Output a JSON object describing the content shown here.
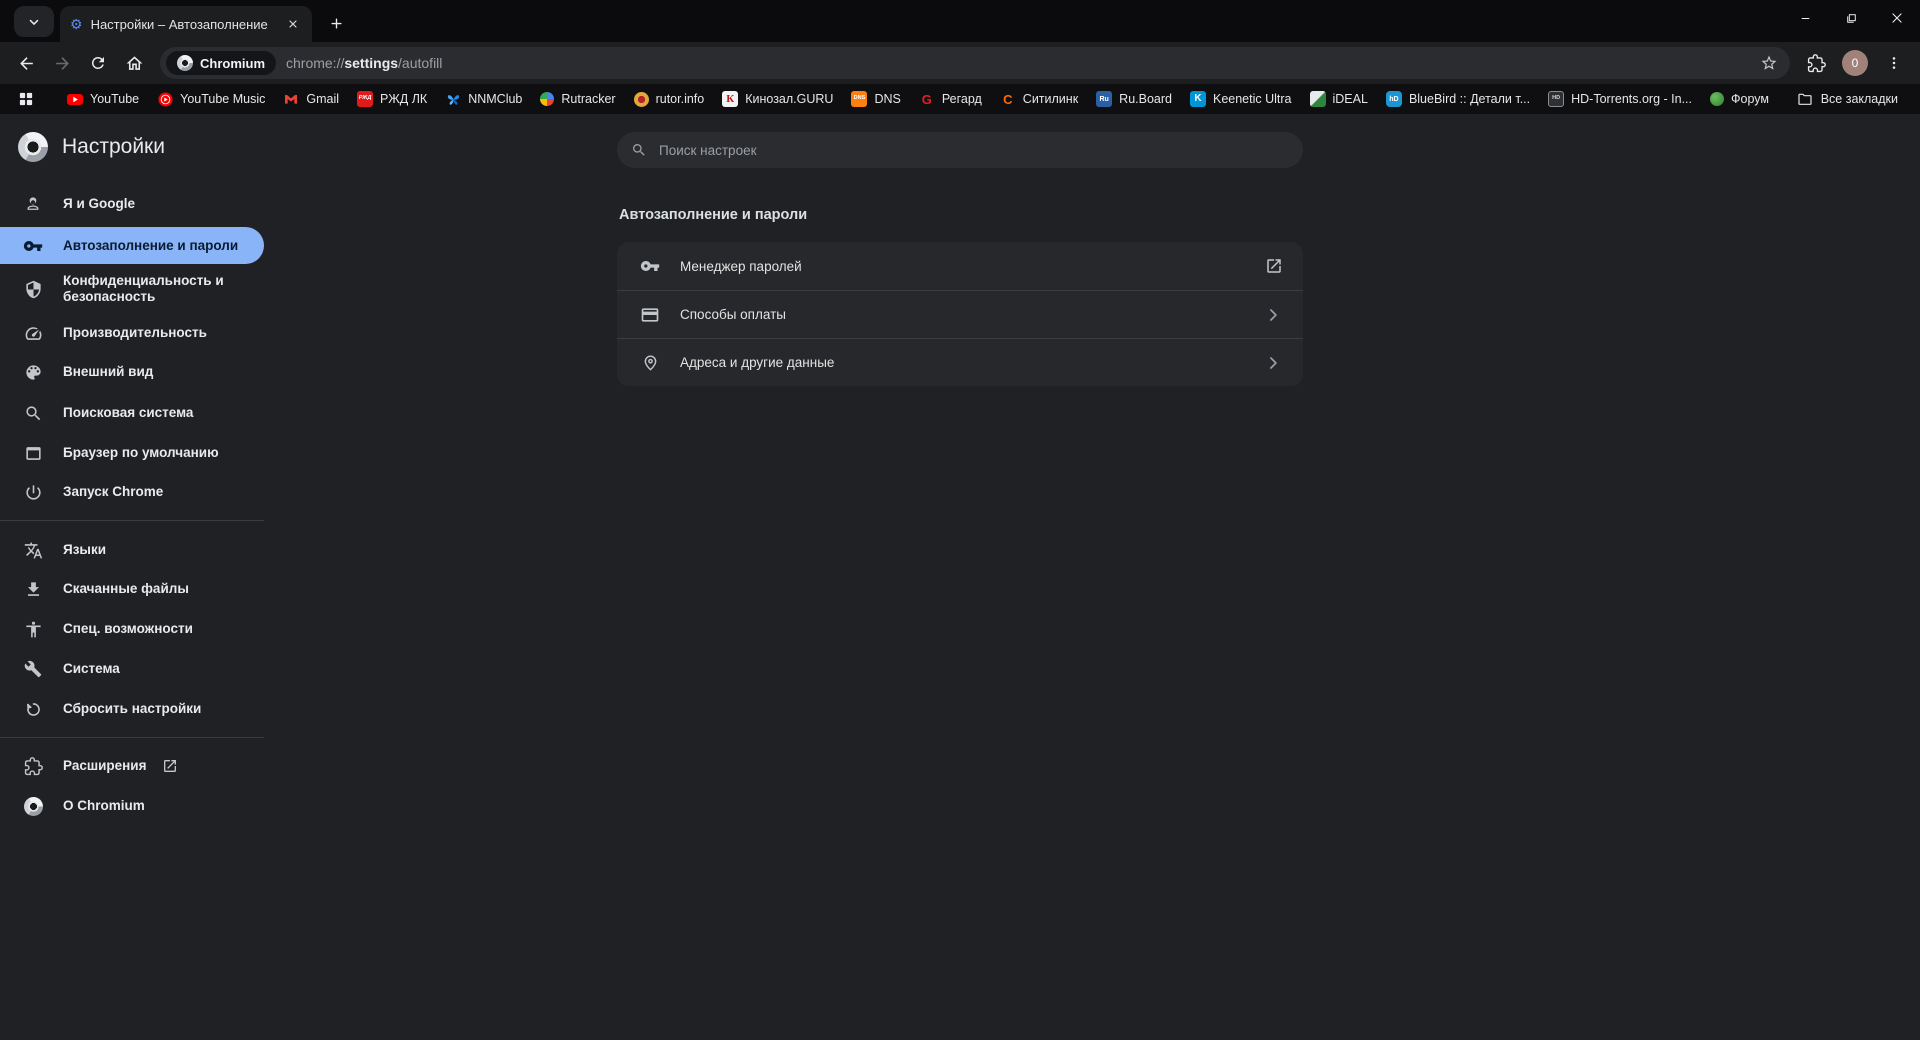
{
  "colors": {
    "accent_selected": "#8ab4f8",
    "selected_text": "#0a1a33",
    "frame": "#0b0b0d",
    "toolbar": "#1d1e20",
    "bookmarks_bar": "#0f0f12",
    "content_bg": "#202124",
    "card_bg": "#27282b",
    "omnibox_bg": "#2b2c2f",
    "avatar_bg": "#a1827a",
    "text_primary": "#e3e3e3",
    "text_secondary": "#9aa0a6"
  },
  "tab": {
    "title": "Настройки – Автозаполнение"
  },
  "toolbar": {
    "site_chip": "Chromium",
    "url_scheme": "chrome://",
    "url_host": "settings",
    "url_path": "/autofill",
    "avatar_letter": "0"
  },
  "bookmarks": {
    "items": [
      {
        "label": "YouTube",
        "icon": "youtube-icon"
      },
      {
        "label": "YouTube Music",
        "icon": "youtube-music-icon"
      },
      {
        "label": "Gmail",
        "icon": "gmail-icon"
      },
      {
        "label": "РЖД ЛК",
        "icon": "rzd-icon",
        "badge": "РЖД"
      },
      {
        "label": "NNMClub",
        "icon": "butterfly-icon"
      },
      {
        "label": "Rutracker",
        "icon": "rutracker-icon"
      },
      {
        "label": "rutor.info",
        "icon": "rutor-icon"
      },
      {
        "label": "Кинозал.GURU",
        "icon": "kinozal-icon",
        "badge": "К"
      },
      {
        "label": "DNS",
        "icon": "dns-icon",
        "badge": "DNS"
      },
      {
        "label": "Регард",
        "icon": "regard-icon",
        "badge": "G"
      },
      {
        "label": "Ситилинк",
        "icon": "citilink-icon",
        "badge": "С"
      },
      {
        "label": "Ru.Board",
        "icon": "ruboard-icon",
        "badge": "Ru"
      },
      {
        "label": "Keenetic Ultra",
        "icon": "keenetic-icon",
        "badge": "K"
      },
      {
        "label": "iDEAL",
        "icon": "ideal-icon"
      },
      {
        "label": "BlueBird :: Детали т...",
        "icon": "bluebird-icon",
        "badge": "hD"
      },
      {
        "label": "HD-Torrents.org - In...",
        "icon": "hd-torrents-icon",
        "badge": "HD"
      },
      {
        "label": "Форум",
        "icon": "forum-icon"
      }
    ],
    "all_bookmarks": "Все закладки"
  },
  "sidebar": {
    "title": "Настройки",
    "items": [
      {
        "label": "Я и Google"
      },
      {
        "label": "Автозаполнение и пароли",
        "selected": true
      },
      {
        "label": "Конфиденциальность и безопасность"
      },
      {
        "label": "Производительность"
      },
      {
        "label": "Внешний вид"
      },
      {
        "label": "Поисковая система"
      },
      {
        "label": "Браузер по умолчанию"
      },
      {
        "label": "Запуск Chrome"
      },
      {
        "label": "Языки"
      },
      {
        "label": "Скачанные файлы"
      },
      {
        "label": "Спец. возможности"
      },
      {
        "label": "Система"
      },
      {
        "label": "Сбросить настройки"
      },
      {
        "label": "Расширения"
      },
      {
        "label": "О Chromium"
      }
    ]
  },
  "main": {
    "search_placeholder": "Поиск настроек",
    "section_title": "Автозаполнение и пароли",
    "card_rows": [
      {
        "label": "Менеджер паролей",
        "trailing": "external"
      },
      {
        "label": "Способы оплаты",
        "trailing": "chevron"
      },
      {
        "label": "Адреса и другие данные",
        "trailing": "chevron"
      }
    ]
  }
}
